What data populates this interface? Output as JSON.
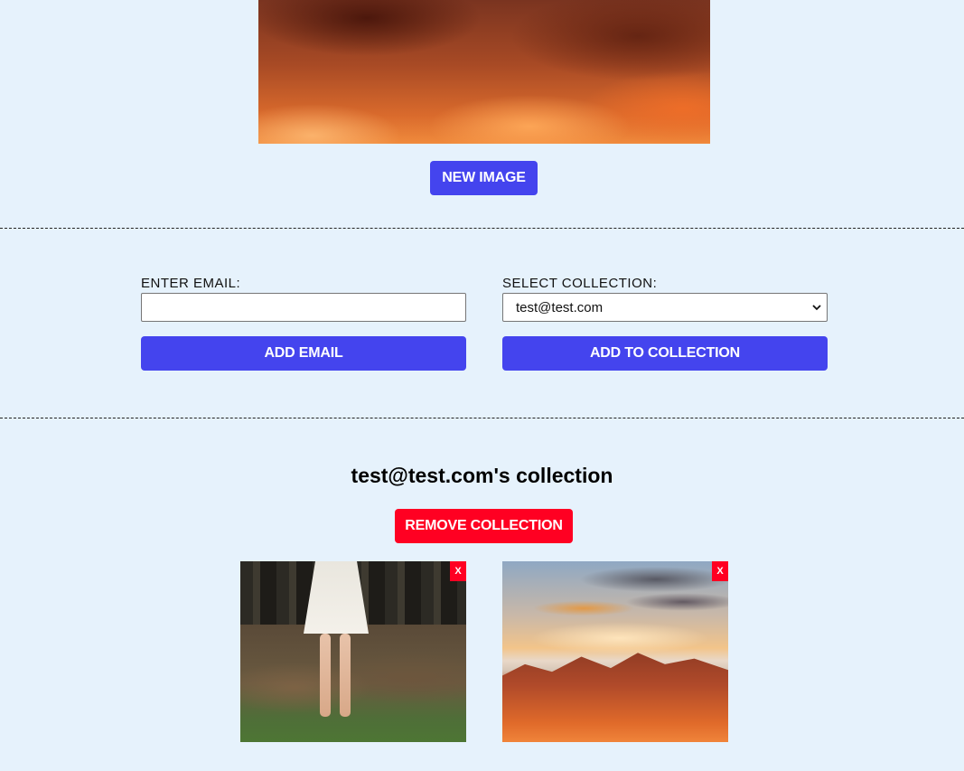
{
  "top_image": {
    "button_label": "NEW IMAGE"
  },
  "form": {
    "email_label": "ENTER EMAIL:",
    "email_value": "",
    "email_placeholder": "",
    "collection_label": "SELECT COLLECTION:",
    "collection_selected": "test@test.com",
    "add_email_label": "ADD EMAIL",
    "add_to_collection_label": "ADD TO COLLECTION"
  },
  "collection": {
    "title": "test@test.com's collection",
    "remove_label": "REMOVE COLLECTION",
    "items": [
      {
        "remove_label": "X",
        "icon": "photo-woman-white-dress"
      },
      {
        "remove_label": "X",
        "icon": "photo-sunset-mountains"
      }
    ]
  },
  "colors": {
    "background": "#e6f2fc",
    "primary_button": "#4444ee",
    "danger_button": "#ff0022"
  }
}
